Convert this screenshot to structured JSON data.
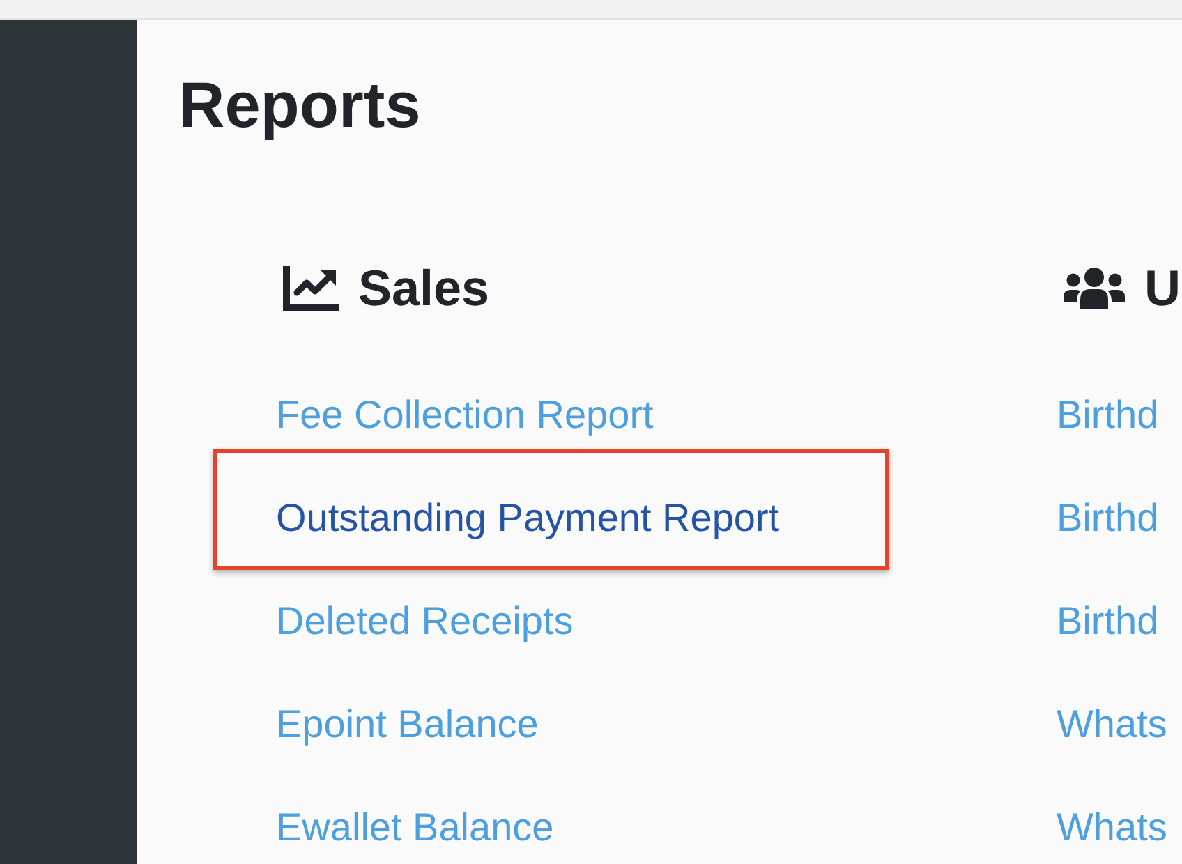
{
  "page_title": "Reports",
  "groups": [
    {
      "kind": "sales",
      "heading": "Sales",
      "links": [
        {
          "label": "Fee Collection Report",
          "highlighted": false
        },
        {
          "label": "Outstanding Payment Report",
          "highlighted": true
        },
        {
          "label": "Deleted Receipts",
          "highlighted": false
        },
        {
          "label": "Epoint Balance",
          "highlighted": false
        },
        {
          "label": "Ewallet Balance",
          "highlighted": false
        }
      ]
    },
    {
      "kind": "users",
      "heading": "U",
      "links": [
        {
          "label": "Birthd",
          "highlighted": false
        },
        {
          "label": "Birthd",
          "highlighted": false
        },
        {
          "label": "Birthd",
          "highlighted": false
        },
        {
          "label": "Whats",
          "highlighted": false
        },
        {
          "label": "Whats",
          "highlighted": false
        }
      ]
    }
  ]
}
